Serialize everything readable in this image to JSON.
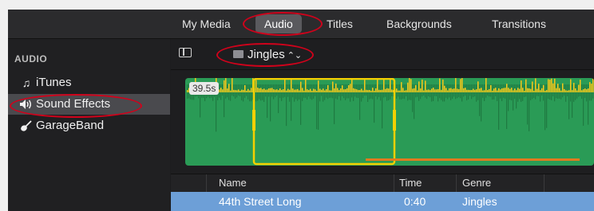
{
  "tabs": [
    {
      "label": "My Media",
      "active": false
    },
    {
      "label": "Audio",
      "active": true
    },
    {
      "label": "Titles",
      "active": false
    },
    {
      "label": "Backgrounds",
      "active": false
    },
    {
      "label": "Transitions",
      "active": false
    }
  ],
  "sidebar": {
    "heading": "AUDIO",
    "items": [
      {
        "label": "iTunes",
        "icon": "music-note-icon",
        "selected": false
      },
      {
        "label": "Sound Effects",
        "icon": "speaker-icon",
        "selected": true
      },
      {
        "label": "GarageBand",
        "icon": "guitar-icon",
        "selected": false
      }
    ]
  },
  "browser": {
    "folder": "Jingles",
    "duration": "39.5s"
  },
  "table": {
    "columns": [
      "Name",
      "Time",
      "Genre"
    ],
    "rows": [
      {
        "name": "44th Street Long",
        "time": "0:40",
        "genre": "Jingles",
        "selected": true
      }
    ]
  },
  "colors": {
    "accent_highlight": "#d0021b",
    "waveform_green": "#2a9b56",
    "waveform_peak": "#f5c518",
    "selection": "#6d9fd7"
  }
}
